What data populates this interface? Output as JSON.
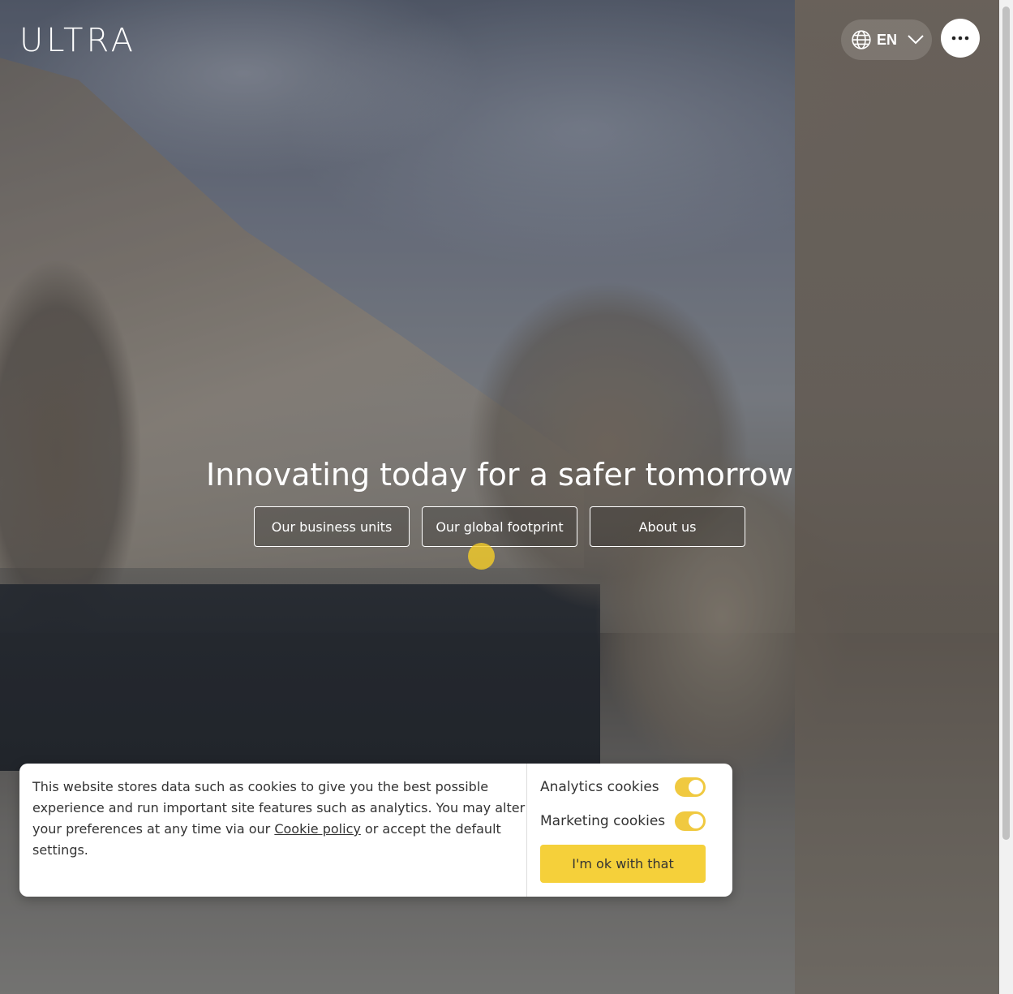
{
  "brand": {
    "logo_text": "ULTRA"
  },
  "header": {
    "language": {
      "code": "EN",
      "icon": "globe-icon",
      "chevron": "chevron-down-icon"
    },
    "menu": {
      "icon": "more-dots-icon"
    }
  },
  "hero": {
    "headline": "Innovating today for a safer tomorrow",
    "buttons": [
      {
        "label": "Our business units"
      },
      {
        "label": "Our global footprint"
      },
      {
        "label": "About us"
      }
    ]
  },
  "cookie_banner": {
    "text_before_link": "This website stores data such as cookies to give you the best possible experience and run important site features such as analytics. You may alter your preferences at any time via our ",
    "link_text": "Cookie policy",
    "text_after_link": " or accept the default settings.",
    "options": [
      {
        "label": "Analytics cookies",
        "enabled": true
      },
      {
        "label": "Marketing cookies",
        "enabled": true
      }
    ],
    "accept_label": "I'm ok with that"
  },
  "colors": {
    "accent": "#f5d03a",
    "toggle_on": "#f0c940",
    "text": "#333333"
  }
}
